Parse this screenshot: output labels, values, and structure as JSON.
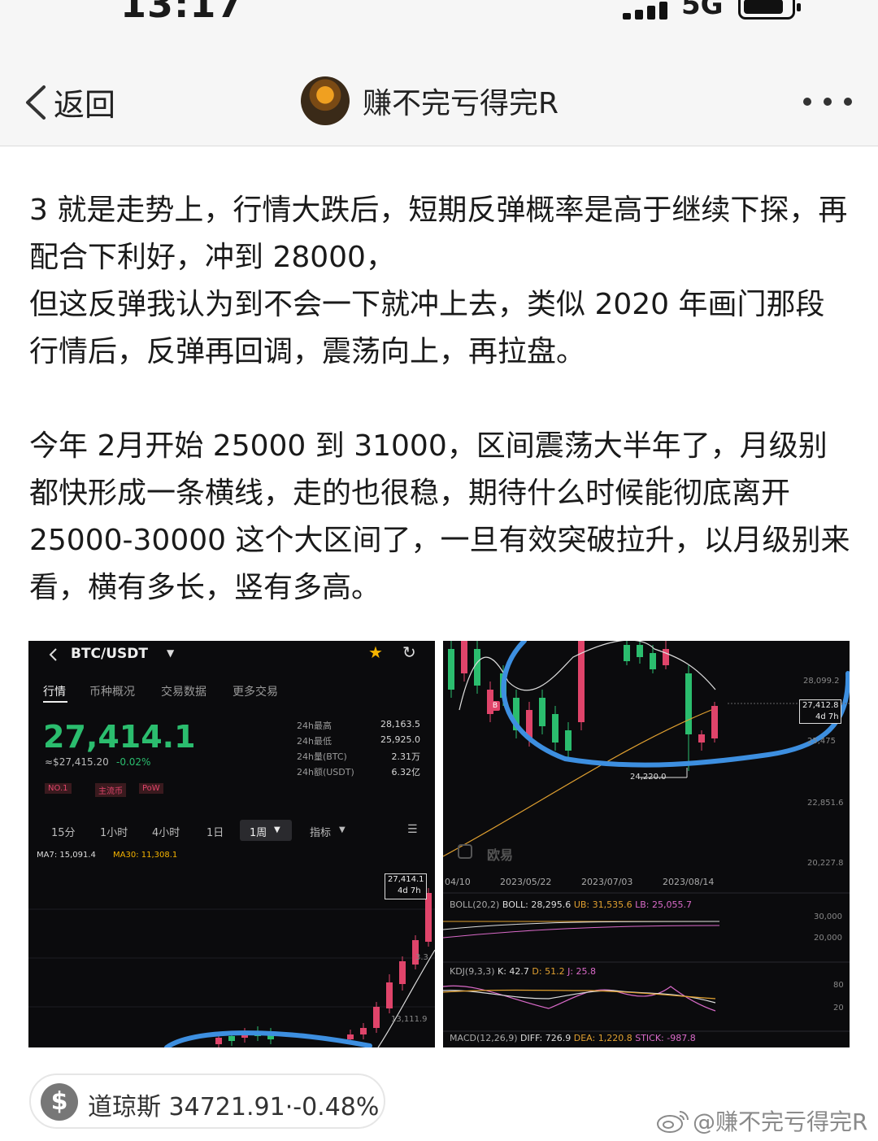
{
  "status_bar": {
    "time": "13:17",
    "network": "5G"
  },
  "nav": {
    "back_label": "返回",
    "username": "赚不完亏得完R"
  },
  "article": {
    "paragraphs": [
      "3 就是走势上，行情大跌后，短期反弹概率是高于继续下探，再配合下利好，冲到 28000，",
      "但这反弹我认为到不会一下就冲上去，类似 2020 年画门那段行情后，反弹再回调，震荡向上，再拉盘。",
      "今年 2月开始 25000 到 31000，区间震荡大半年了，月级别都快形成一条横线，走的也很稳，期待什么时候能彻底离开 25000-30000 这个大区间了，一旦有效突破拉升，以月级别来看，横有多长，竖有多高。"
    ]
  },
  "image1": {
    "pair": "BTC/USDT",
    "tabs": [
      "行情",
      "币种概况",
      "交易数据",
      "更多交易"
    ],
    "price": "27,414.1",
    "price_sub": "≈$27,415.20",
    "change": "-0.02%",
    "tags": [
      "NO.1",
      "主流币",
      "PoW"
    ],
    "stats": [
      {
        "label": "24h最高",
        "value": "28,163.5"
      },
      {
        "label": "24h最低",
        "value": "25,925.0"
      },
      {
        "label": "24h量(BTC)",
        "value": "2.31万"
      },
      {
        "label": "24h额(USDT)",
        "value": "6.32亿"
      }
    ],
    "intervals": [
      "15分",
      "1小时",
      "4小时",
      "1日",
      "1周",
      "指标"
    ],
    "ma7": "MA7: 15,091.4",
    "ma30": "MA30: 11,308.1",
    "price_tag": "27,414.1",
    "price_tag_sub": "4d 7h",
    "axis_labels": [
      "3.3",
      "13,111.9"
    ],
    "colors": {
      "up": "#2bbd6e",
      "down": "#e0446a",
      "accent": "#f5b300",
      "annotation": "#3d8fe0"
    }
  },
  "image2": {
    "price_levels": [
      "28,099.2",
      "25,475",
      "22,851.6",
      "20,227.8"
    ],
    "price_tag": "27,412.8",
    "price_tag_sub": "4d 7h",
    "low_label": "24,220.0",
    "dates": [
      "04/10",
      "2023/05/22",
      "2023/07/03",
      "2023/08/14"
    ],
    "exchange": "欧易",
    "boll": {
      "name": "BOLL(20,2)",
      "boll": "BOLL: 28,295.6",
      "ub": "UB: 31,535.6",
      "lb": "LB: 25,055.7"
    },
    "boll_axis": [
      "30,000",
      "20,000"
    ],
    "kdj": {
      "name": "KDJ(9,3,3)",
      "k": "K: 42.7",
      "d": "D: 51.2",
      "j": "J: 25.8"
    },
    "kdj_axis": [
      "80",
      "20"
    ],
    "macd": {
      "name": "MACD(12,26,9)",
      "diff": "DIFF: 726.9",
      "dea": "DEA: 1,220.8",
      "stick": "STICK: -987.8"
    },
    "marker": "B"
  },
  "footer": {
    "stock_name": "道琼斯",
    "stock_value": "34721.91",
    "stock_change": "-0.48%",
    "watermark": "@赚不完亏得完R"
  }
}
